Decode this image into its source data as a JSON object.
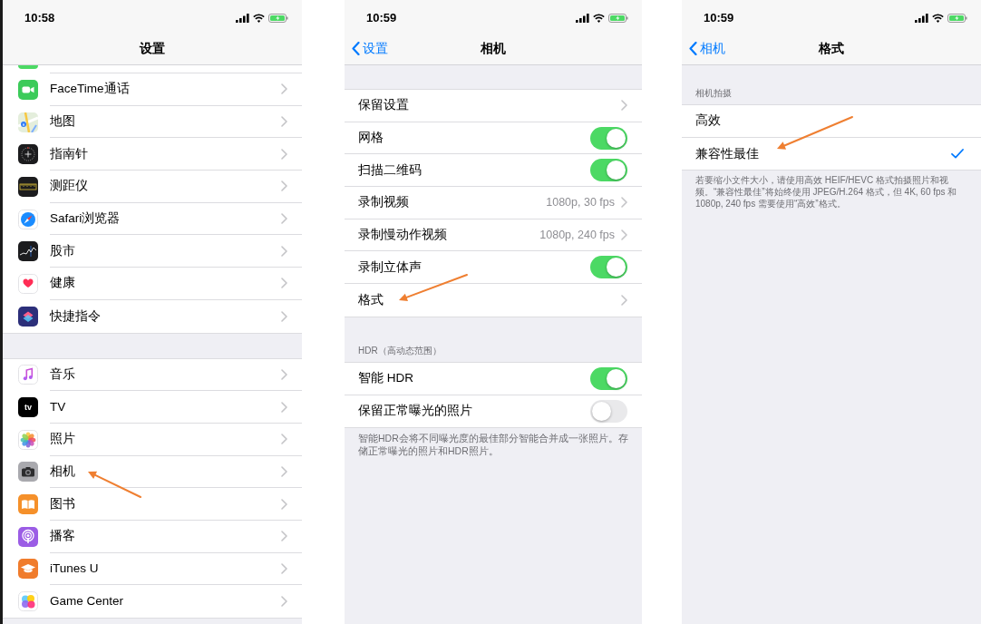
{
  "screens": [
    {
      "status_bar": {
        "time": "10:58"
      },
      "nav_bar": {
        "title": "设置"
      },
      "groups": [
        {
          "rows": [
            {
              "kind": "link",
              "label": "FaceTime通话",
              "marked": false
            },
            {
              "kind": "link",
              "label": "地图",
              "marked": false
            },
            {
              "kind": "link",
              "label": "指南针",
              "marked": false
            },
            {
              "kind": "link",
              "label": "测距仪",
              "marked": false
            },
            {
              "kind": "link",
              "label": "Safari浏览器",
              "marked": false
            },
            {
              "kind": "link",
              "label": "股市",
              "marked": false
            },
            {
              "kind": "link",
              "label": "健康",
              "marked": false
            },
            {
              "kind": "link",
              "label": "快捷指令",
              "marked": false
            }
          ]
        },
        {
          "rows": [
            {
              "kind": "link",
              "label": "音乐",
              "marked": false
            },
            {
              "kind": "link",
              "label": "TV",
              "icon_text": "tv",
              "marked": false
            },
            {
              "kind": "link",
              "label": "照片",
              "marked": false
            },
            {
              "kind": "link",
              "label": "相机",
              "marked": true
            },
            {
              "kind": "link",
              "label": "图书",
              "marked": false
            },
            {
              "kind": "link",
              "label": "播客",
              "marked": false
            },
            {
              "kind": "link",
              "label": "iTunes U",
              "marked": false
            },
            {
              "kind": "link",
              "label": "Game Center",
              "marked": false
            }
          ]
        }
      ]
    },
    {
      "status_bar": {
        "time": "10:59"
      },
      "nav_bar": {
        "back": "设置",
        "title": "相机"
      },
      "groups": [
        {
          "rows": [
            {
              "kind": "link",
              "label": "保留设置",
              "marked": false
            },
            {
              "kind": "toggle",
              "label": "网格",
              "on": true,
              "marked": false
            },
            {
              "kind": "toggle",
              "label": "扫描二维码",
              "on": true,
              "marked": false
            },
            {
              "kind": "link",
              "label": "录制视频",
              "value": "1080p, 30 fps",
              "marked": false
            },
            {
              "kind": "link",
              "label": "录制慢动作视频",
              "value": "1080p, 240 fps",
              "marked": false
            },
            {
              "kind": "toggle",
              "label": "录制立体声",
              "on": true,
              "marked": false
            },
            {
              "kind": "link",
              "label": "格式",
              "marked": true
            }
          ]
        },
        {
          "header": "HDR（高动态范围）",
          "rows": [
            {
              "kind": "toggle",
              "label": "智能 HDR",
              "on": true,
              "marked": false
            },
            {
              "kind": "toggle",
              "label": "保留正常曝光的照片",
              "on": false,
              "marked": false
            }
          ],
          "footer": "智能HDR会将不同曝光度的最佳部分智能合并成一张照片。存储正常曝光的照片和HDR照片。"
        }
      ]
    },
    {
      "status_bar": {
        "time": "10:59"
      },
      "nav_bar": {
        "back": "相机",
        "title": "格式"
      },
      "groups": [
        {
          "header": "相机拍摄",
          "rows": [
            {
              "kind": "choice",
              "label": "高效",
              "selected": false,
              "marked": false
            },
            {
              "kind": "choice",
              "label": "兼容性最佳",
              "selected": true,
              "marked": true
            }
          ],
          "footer": "若要缩小文件大小，请使用高效 HEIF/HEVC 格式拍摄照片和视频。“兼容性最佳”将始终使用 JPEG/H.264 格式，但 4K, 60 fps 和 1080p, 240 fps 需要使用“高效”格式。"
        }
      ]
    }
  ]
}
